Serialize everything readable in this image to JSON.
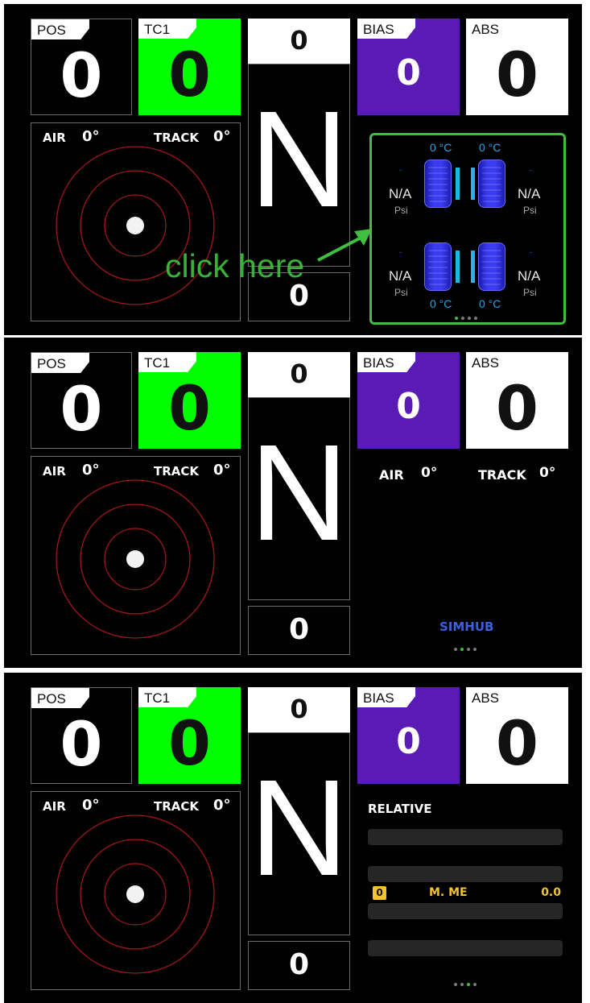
{
  "panels": [
    {
      "pos": {
        "label": "POS",
        "value": "0"
      },
      "tc1": {
        "label": "TC1",
        "value": "0"
      },
      "gear": {
        "top": "0",
        "value": "N",
        "bottom": "0"
      },
      "bias": {
        "label": "BIAS",
        "value": "0"
      },
      "abs": {
        "label": "ABS",
        "value": "0"
      },
      "radar": {
        "air_label": "AIR",
        "air_value": "0°",
        "track_label": "TRACK",
        "track_value": "0°"
      },
      "tyres": {
        "temp_fl": "0 °C",
        "temp_fr": "0 °C",
        "temp_rl": "0 °C",
        "temp_rr": "0 °C",
        "press_fl": "N/A",
        "press_fr": "N/A",
        "press_rl": "N/A",
        "press_rr": "N/A",
        "unit": "Psi",
        "marker": "-"
      },
      "annotation": "click here"
    },
    {
      "pos": {
        "label": "POS",
        "value": "0"
      },
      "tc1": {
        "label": "TC1",
        "value": "0"
      },
      "gear": {
        "top": "0",
        "value": "N",
        "bottom": "0"
      },
      "bias": {
        "label": "BIAS",
        "value": "0"
      },
      "abs": {
        "label": "ABS",
        "value": "0"
      },
      "radar": {
        "air_label": "AIR",
        "air_value": "0°",
        "track_label": "TRACK",
        "track_value": "0°"
      },
      "weather": {
        "air_label": "AIR",
        "air_value": "0°",
        "track_label": "TRACK",
        "track_value": "0°"
      },
      "brand": "SIMHUB"
    },
    {
      "pos": {
        "label": "POS",
        "value": "0"
      },
      "tc1": {
        "label": "TC1",
        "value": "0"
      },
      "gear": {
        "top": "0",
        "value": "N",
        "bottom": "0"
      },
      "bias": {
        "label": "BIAS",
        "value": "0"
      },
      "abs": {
        "label": "ABS",
        "value": "0"
      },
      "radar": {
        "air_label": "AIR",
        "air_value": "0°",
        "track_label": "TRACK",
        "track_value": "0°"
      },
      "relative": {
        "title": "RELATIVE",
        "me_position": "0",
        "me_name": "M. ME",
        "me_gap": "0.0"
      }
    }
  ],
  "colors": {
    "tc1_green": "#00ff00",
    "bias_purple": "#5a1ab4",
    "annotation_green": "#3ec03e",
    "tyre_blue": "#3b3bf0",
    "temp_blue": "#2aa3e8",
    "radar_red": "#a01818",
    "simhub_blue": "#3f5fe0",
    "position_badge_yellow": "#f2c230"
  },
  "page_indicator": {
    "count": 4,
    "active": [
      0,
      1,
      2
    ]
  }
}
